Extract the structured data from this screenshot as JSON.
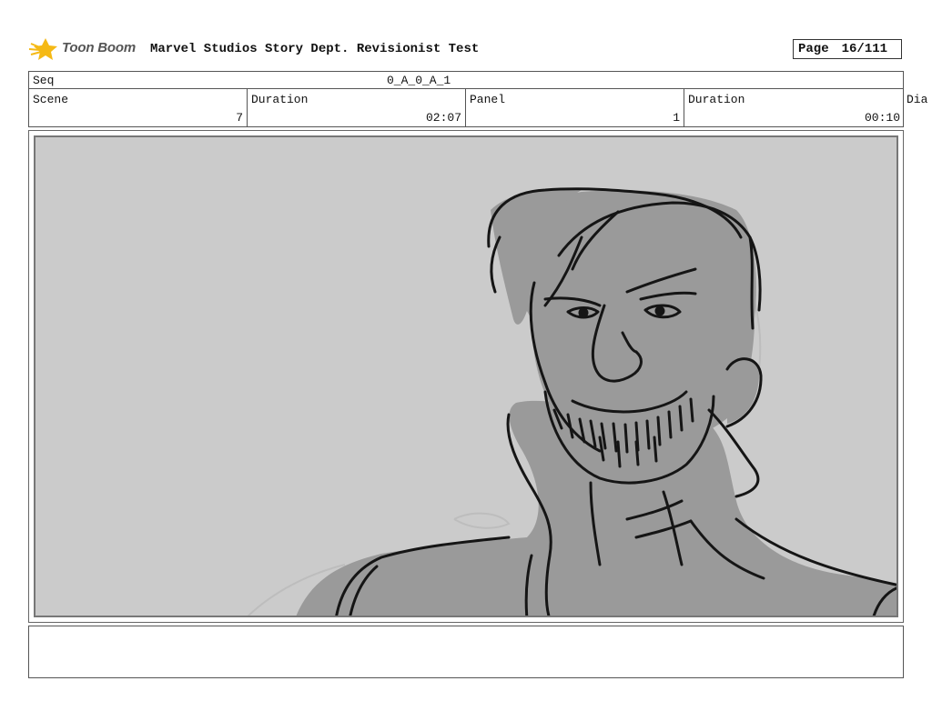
{
  "header": {
    "logo_text": "Toon Boom",
    "title": "Marvel Studios Story Dept. Revisionist Test",
    "page_label": "Page",
    "page_number": "16/111"
  },
  "sequence": {
    "label": "Seq",
    "value": "0_A_0_A_1"
  },
  "info": {
    "scene_label": "Scene",
    "scene_value": "7",
    "scene_duration_label": "Duration",
    "scene_duration_value": "02:07",
    "panel_label": "Panel",
    "panel_value": "1",
    "panel_duration_label": "Duration",
    "panel_duration_value": "00:10",
    "dialog_label": "Dia"
  },
  "colors": {
    "logo_accent": "#f5b915",
    "panel_bg": "#cbcbcb",
    "figure_fill": "#9a9a9a",
    "line": "#151515"
  },
  "icons": {
    "logo": "toon-boom-star-icon"
  }
}
